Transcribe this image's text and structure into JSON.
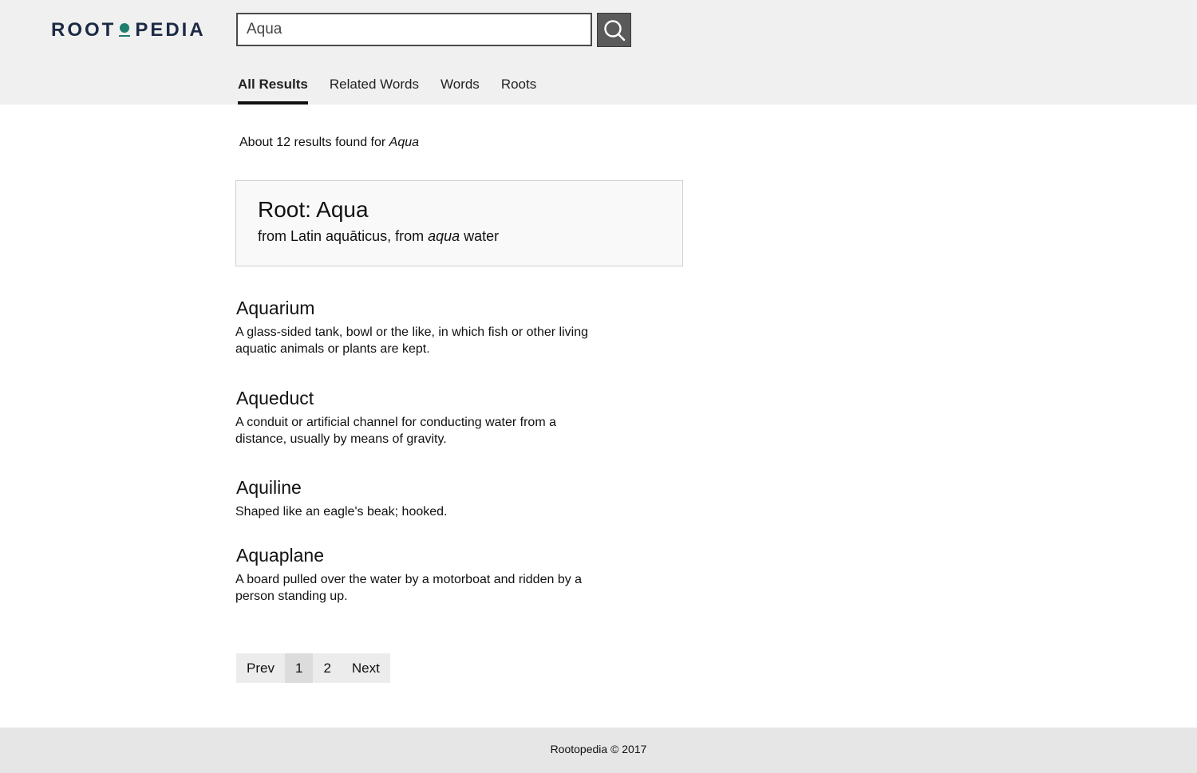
{
  "logo": {
    "left": "ROOT",
    "right": "PEDIA",
    "accent_color": "#1e7d6e",
    "text_color": "#1c2a44"
  },
  "search": {
    "value": "Aqua",
    "button_icon": "search-icon"
  },
  "tabs": [
    {
      "label": "All Results",
      "active": true
    },
    {
      "label": "Related Words",
      "active": false
    },
    {
      "label": "Words",
      "active": false
    },
    {
      "label": "Roots",
      "active": false
    }
  ],
  "results_summary": {
    "prefix": "About 12 results found for ",
    "query": "Aqua"
  },
  "root_card": {
    "title": "Root: Aqua",
    "origin_prefix": "from Latin aquāticus, from ",
    "origin_term": "aqua",
    "origin_suffix": " water"
  },
  "results": [
    {
      "title": "Aquarium",
      "definition": "A glass-sided tank, bowl or the like, in which fish or other living aquatic animals or plants are kept."
    },
    {
      "title": "Aqueduct",
      "definition": "A conduit or artificial channel for conducting water from a distance, usually by means of gravity."
    },
    {
      "title": "Aquiline",
      "definition": "Shaped like an eagle's beak; hooked."
    },
    {
      "title": "Aquaplane",
      "definition": "A board pulled over the water by a motorboat and ridden by a person standing up."
    }
  ],
  "pagination": {
    "prev": "Prev",
    "pages": [
      "1",
      "2"
    ],
    "current": "1",
    "next": "Next"
  },
  "footer": {
    "text": "Rootopedia © 2017"
  }
}
